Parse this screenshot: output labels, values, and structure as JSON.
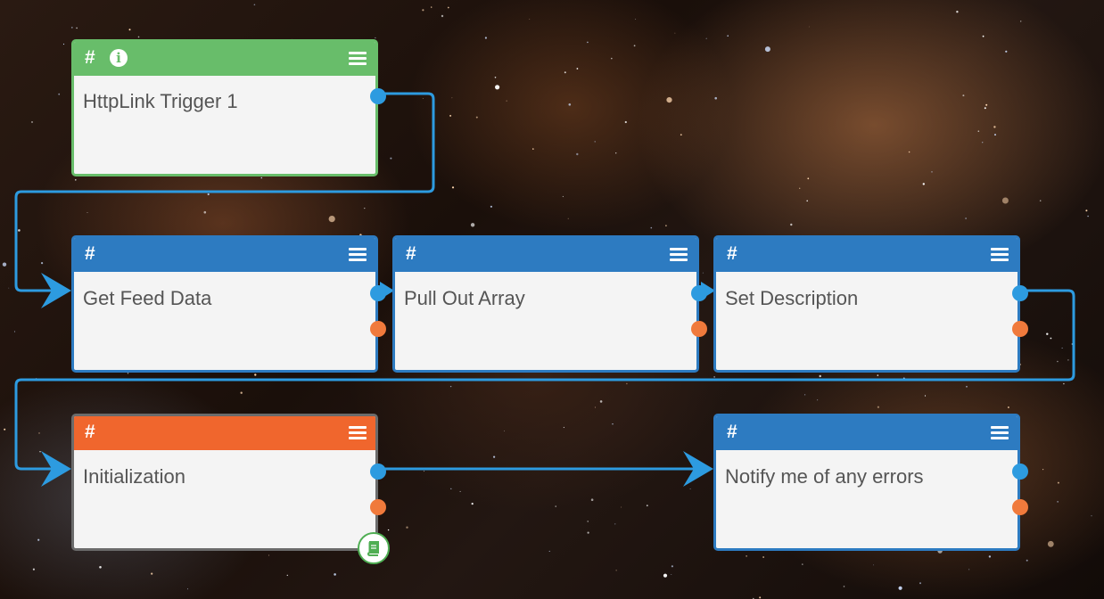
{
  "nodes": {
    "trigger": {
      "hash": "#",
      "info": "i",
      "title": "HttpLink Trigger 1"
    },
    "get_feed": {
      "hash": "#",
      "title": "Get Feed Data"
    },
    "pull_array": {
      "hash": "#",
      "title": "Pull Out Array"
    },
    "set_desc": {
      "hash": "#",
      "title": "Set Description"
    },
    "init": {
      "hash": "#",
      "title": "Initialization"
    },
    "notify": {
      "hash": "#",
      "title": "Notify me of any errors"
    }
  },
  "icons": {
    "info": "info-icon",
    "menu": "menu-icon",
    "book": "book-icon",
    "success_port": "output-port-icon",
    "error_port": "error-port-icon"
  },
  "colors": {
    "trigger": "#68bd6a",
    "step": "#2d7bc1",
    "init": "#f0662d",
    "wire": "#2d9be0",
    "error_port": "#f07a3c"
  }
}
